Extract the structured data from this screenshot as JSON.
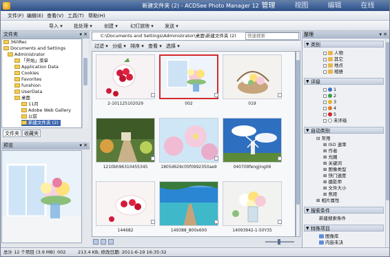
{
  "window": {
    "title": "新建文件夹 (2) - ACDSee Photo Manager 12",
    "modes": [
      "管理",
      "视图",
      "编辑",
      "在线"
    ],
    "active_mode": "管理"
  },
  "menu": [
    "文件(F)",
    "编辑(E)",
    "查看(V)",
    "工具(T)",
    "帮助(H)"
  ],
  "toolbar": [
    "导入 ▾",
    "批处理 ▾",
    "创建 ▾",
    "幻灯放映 ▾",
    "发送 ▾"
  ],
  "left_panel": {
    "folders_title": "文件夹",
    "tree": [
      "360Rec",
      "Documents and Settings",
      "Administrator",
      "「开始」菜单",
      "Application Data",
      "Cookies",
      "Favorites",
      "funshion",
      "UserData",
      "桌面",
      "11月",
      "Adobe Web Gallery",
      "以前",
      "新建文件夹 (2)"
    ],
    "tabs": [
      "文件夹",
      "收藏夹"
    ],
    "preview_title": "预览"
  },
  "path": "C:\\Documents and Settings\\Administrator\\桌面\\新建文件夹 (2)",
  "quick_search_placeholder": "快速搜索",
  "filter_bar": [
    "过滤 ▾",
    "分组 ▾",
    "排序 ▾",
    "查看 ▾",
    "选择 ▾"
  ],
  "thumbnails": [
    {
      "caption": "2-101125102029",
      "scene": "raspberries"
    },
    {
      "caption": "002",
      "scene": "window-flowers",
      "selected": true
    },
    {
      "caption": "019",
      "scene": "flower-basket"
    },
    {
      "caption": "1210bh96310455345",
      "scene": "garden-path"
    },
    {
      "caption": "1805d629c05f0992350ae9",
      "scene": "pink-flowers"
    },
    {
      "caption": "040709fengjing06",
      "scene": "windmill"
    },
    {
      "caption": "144682",
      "scene": "raspberries-2"
    },
    {
      "caption": "149388_800x600",
      "scene": "beach-pier"
    },
    {
      "caption": "14093942-1-50Y35",
      "scene": "flower-vase"
    }
  ],
  "right_panel": {
    "title": "整理",
    "categories_title": "类别",
    "categories": [
      "人物",
      "其它",
      "地点",
      "相册"
    ],
    "ratings_title": "评级",
    "ratings": [
      "1",
      "2",
      "3",
      "4",
      "5",
      "未评级"
    ],
    "auto_title": "自动类别",
    "auto_group": "常用",
    "auto_items": [
      "ISO 速率",
      "作者",
      "光圈",
      "关键词",
      "图像类型",
      "快门速度",
      "摄影师",
      "文件大小",
      "焦距"
    ],
    "photo_props": "相片属性",
    "search_title": "搜索条件",
    "search_new": "新建搜索条件",
    "special_title": "特殊项目",
    "special_items": [
      "图像库",
      "内嵌未决"
    ]
  },
  "status": {
    "total": "总计 12 个项目 (3.9 MB)",
    "file": "002",
    "info": "213.4 KB, 修改日期: 2011-6-19 16:35:32"
  },
  "colors": {
    "accent": "#3c67b1",
    "selected_border": "#d2282e"
  }
}
